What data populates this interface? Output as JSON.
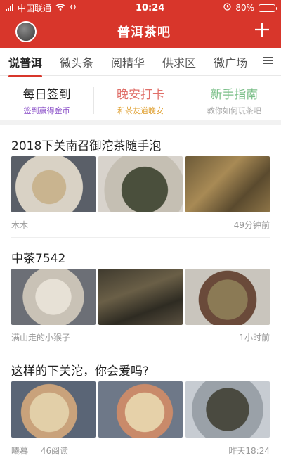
{
  "status_bar": {
    "carrier": "中国联通",
    "time": "10:24",
    "battery": "80%",
    "battery_level": 0.8
  },
  "header": {
    "title": "普洱茶吧"
  },
  "tabs": [
    {
      "label": "说普洱",
      "active": true
    },
    {
      "label": "微头条",
      "active": false
    },
    {
      "label": "阅精华",
      "active": false
    },
    {
      "label": "供求区",
      "active": false
    },
    {
      "label": "微广场",
      "active": false
    }
  ],
  "quick_actions": [
    {
      "title": "每日签到",
      "subtitle": "签到赢得金币",
      "title_color": "#222222",
      "subtitle_color": "#8a4fc8"
    },
    {
      "title": "晚安打卡",
      "subtitle": "和茶友道晚安",
      "title_color": "#e0706a",
      "subtitle_color": "#e0a030"
    },
    {
      "title": "新手指南",
      "subtitle": "教你如何玩茶吧",
      "title_color": "#7cc08a",
      "subtitle_color": "#a8a8a8"
    }
  ],
  "posts": [
    {
      "title": "2018下关南召御沱茶随手泡",
      "author": "木木",
      "time": "49分钟前"
    },
    {
      "title": "中茶7542",
      "author": "满山走的小猴子",
      "time": "1小时前"
    },
    {
      "title": "这样的下关沱，你会爱吗?",
      "author": "曦暮",
      "reads": "46阅读",
      "time": "昨天18:24"
    }
  ],
  "colors": {
    "brand_red": "#d8362b"
  },
  "icons": [
    "wifi-icon",
    "alarm-icon",
    "battery-icon",
    "plus-icon",
    "menu-icon"
  ]
}
